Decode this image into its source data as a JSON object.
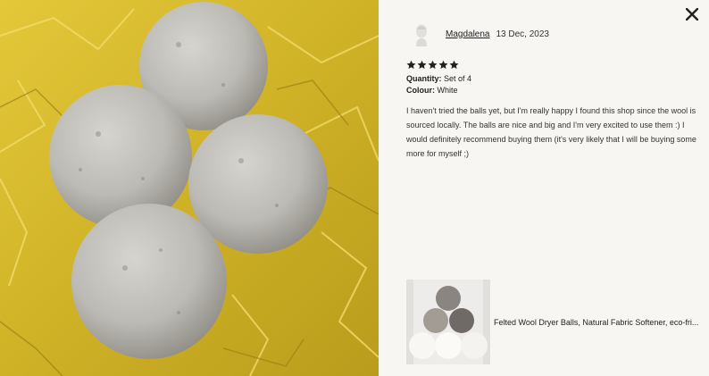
{
  "review": {
    "reviewer_name": "Magdalena",
    "date": "13 Dec, 2023",
    "rating": 5,
    "quantity_label": "Quantity:",
    "quantity_value": "Set of 4",
    "colour_label": "Colour:",
    "colour_value": "White",
    "text": "I haven't tried the balls yet, but I'm really happy I found this shop since the wool is sourced locally. The balls are nice and big and I'm very excited to use them :) I would definitely recommend buying them (it's very likely that I will be buying some more for myself ;)"
  },
  "product": {
    "title": "Felted Wool Dryer Balls, Natural Fabric Softener, eco-fri..."
  },
  "icons": {
    "close": "close-icon",
    "avatar": "avatar-icon",
    "star": "star-icon"
  },
  "colors": {
    "panel_background": "#f7f6f2",
    "star": "#222222",
    "photo_background": "#d8bd2c"
  }
}
